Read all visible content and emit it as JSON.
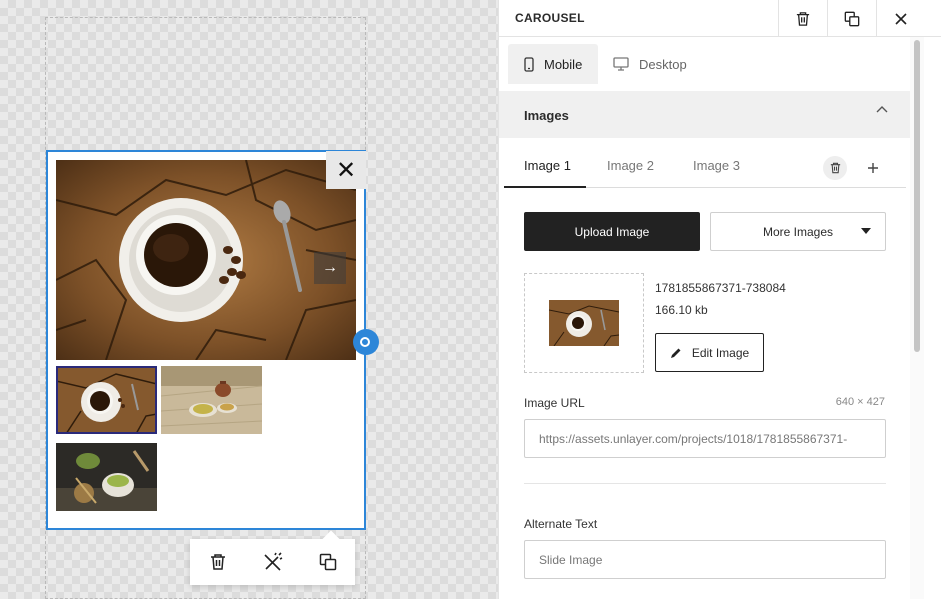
{
  "panel": {
    "title": "CAROUSEL",
    "device_tabs": [
      "Mobile",
      "Desktop"
    ],
    "active_device": "Mobile",
    "section_title": "Images",
    "image_tabs": [
      "Image 1",
      "Image 2",
      "Image 3"
    ],
    "active_image_tab": "Image 1",
    "upload_button": "Upload Image",
    "more_images_button": "More Images",
    "file": {
      "name": "1781855867371-738084",
      "size": "166.10 kb"
    },
    "edit_image_button": "Edit Image",
    "image_url": {
      "label": "Image URL",
      "dimensions": "640 × 427",
      "value": "https://assets.unlayer.com/projects/1018/1781855867371-"
    },
    "alt_text": {
      "label": "Alternate Text",
      "placeholder": "Slide Image"
    }
  },
  "canvas": {
    "carousel_images": [
      "coffee-cup-on-wood",
      "tea-set-on-burlap",
      "matcha-tea-set"
    ],
    "selected_thumbnail": 1
  },
  "icons": {
    "header": [
      "trash-icon",
      "duplicate-icon",
      "close-icon"
    ],
    "toolbar": [
      "trash-icon",
      "magic-wand-icon",
      "duplicate-icon"
    ],
    "image_tabs": [
      "trash-icon",
      "plus-icon"
    ],
    "device": [
      "phone-icon",
      "desktop-icon"
    ]
  },
  "colors": {
    "accent": "#2d86d8",
    "dark_button": "#222222",
    "section_bg": "#f0f0f0"
  }
}
